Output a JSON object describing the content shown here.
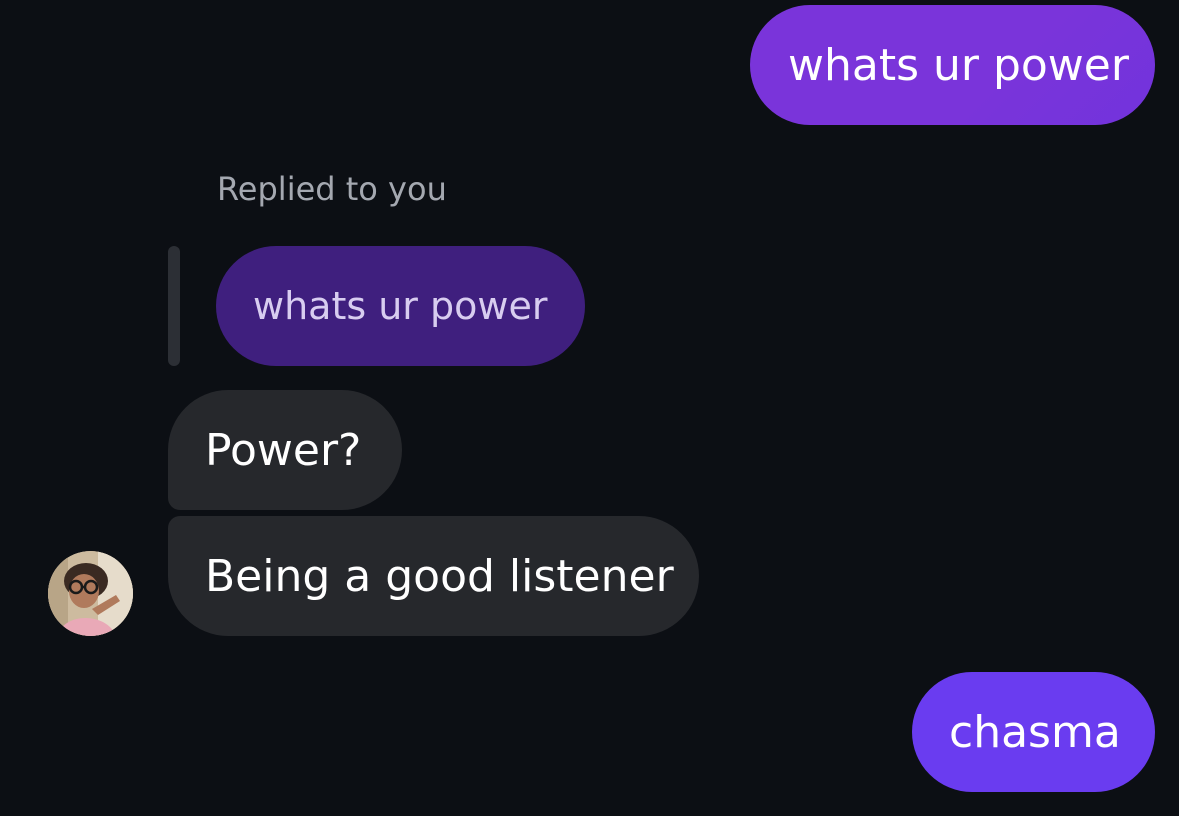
{
  "messages": {
    "outgoing_1": "whats ur power",
    "reply_caption": "Replied to you",
    "quoted_text": "whats ur power",
    "incoming_1": "Power?",
    "incoming_2": "Being a good listener",
    "outgoing_2": "chasma"
  },
  "colors": {
    "background": "#0c0f14",
    "outgoing_bubble": "#7a34da",
    "outgoing_bubble_latest": "#6a3cf0",
    "quoted_bubble": "#3f1f7e",
    "incoming_bubble": "#26282c",
    "caption_text": "#a4a8b0"
  },
  "icons": {
    "sender_avatar": "profile-photo"
  }
}
